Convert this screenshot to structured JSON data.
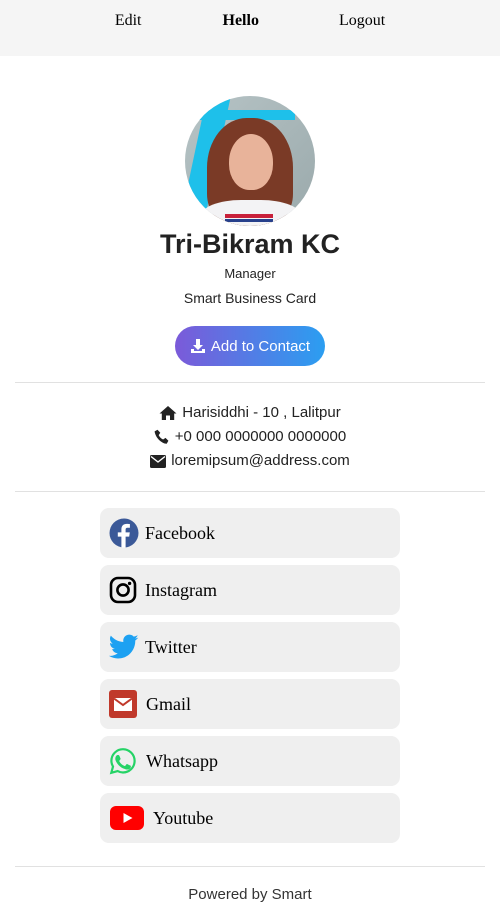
{
  "nav": {
    "edit": "Edit",
    "title": "Hello",
    "logout": "Logout"
  },
  "profile": {
    "name": "Tri-Bikram KC",
    "role": "Manager",
    "card_type": "Smart Business Card",
    "add_button": "Add to Contact"
  },
  "contact": {
    "address": "Harisiddhi - 10 , Lalitpur",
    "phone": "+0 000 0000000 0000000",
    "email": "loremipsum@address.com"
  },
  "links": [
    {
      "label": "Facebook",
      "icon": "facebook-icon",
      "color": "#3b5998"
    },
    {
      "label": "Instagram",
      "icon": "instagram-icon",
      "color": "#000000"
    },
    {
      "label": "Twitter",
      "icon": "twitter-icon",
      "color": "#1da1f2"
    },
    {
      "label": "Gmail",
      "icon": "gmail-icon",
      "color": "#c0392b"
    },
    {
      "label": "Whatsapp",
      "icon": "whatsapp-icon",
      "color": "#25d366"
    },
    {
      "label": "Youtube",
      "icon": "youtube-icon",
      "color": "#ff0000"
    }
  ],
  "footer": "Powered by Smart"
}
